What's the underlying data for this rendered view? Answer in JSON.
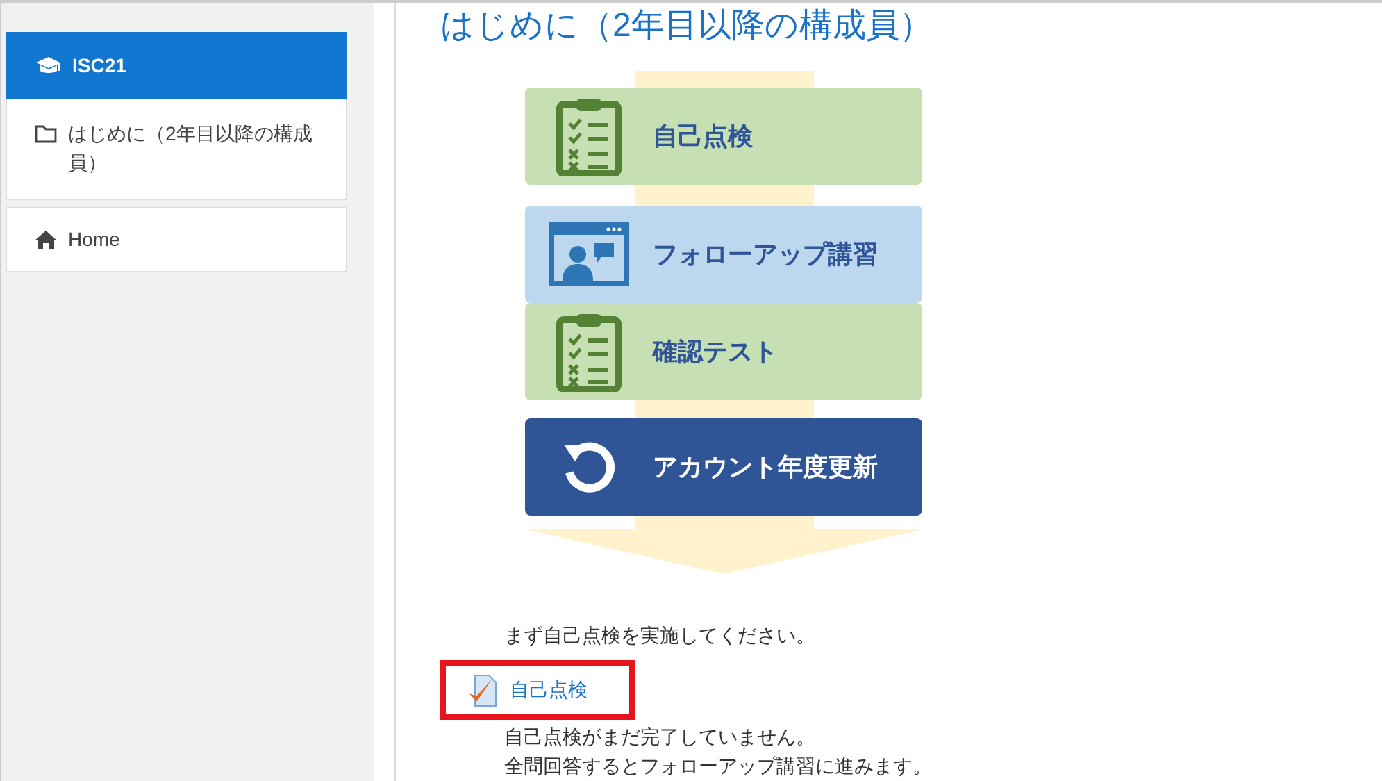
{
  "sidebar": {
    "course": {
      "title": "ISC21",
      "selected": true
    },
    "items": [
      {
        "label": "はじめに（2年目以降の構成員）",
        "kind": "folder"
      }
    ],
    "home": {
      "label": "Home"
    }
  },
  "main": {
    "title": "はじめに（2年目以降の構成員）",
    "steps": [
      {
        "label": "自己点検",
        "kind": "clipboard",
        "color": "#c6e0b4"
      },
      {
        "label": "フォローアップ講習",
        "kind": "video",
        "color": "#bdd7ee"
      },
      {
        "label": "確認テスト",
        "kind": "clipboard",
        "color": "#c6e0b4"
      },
      {
        "label": "アカウント年度更新",
        "kind": "refresh",
        "color": "#2f5597"
      }
    ],
    "intro": "まず自己点検を実施してください。",
    "activity": {
      "label": "自己点検",
      "highlighted": true
    },
    "notes": [
      "自己点検がまだ完了していません。",
      "全問回答するとフォローアップ講習に進みます。"
    ]
  }
}
